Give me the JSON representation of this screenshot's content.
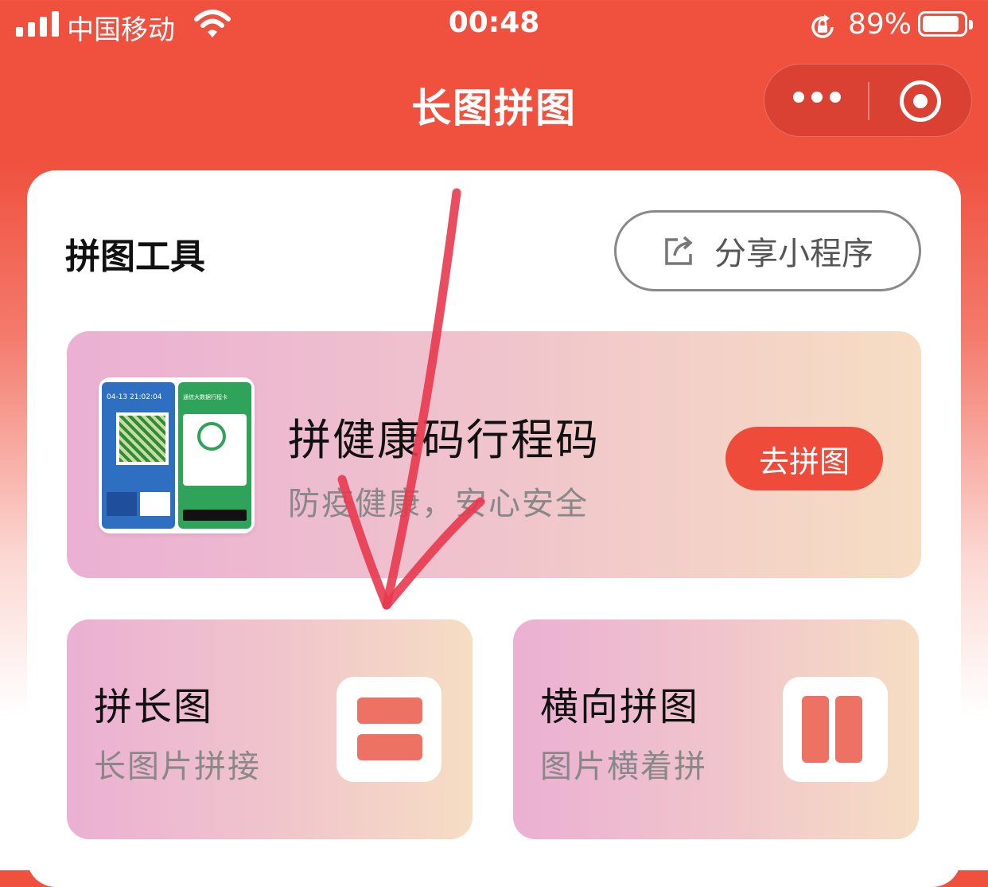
{
  "status_bar": {
    "carrier": "中国移动",
    "time": "00:48",
    "battery": "89%",
    "battery_level": 0.89
  },
  "nav": {
    "title": "长图拼图"
  },
  "main": {
    "section_title": "拼图工具",
    "share_label": "分享小程序",
    "feature": {
      "title": "拼健康码行程码",
      "subtitle": "防疫健康，安心安全",
      "button": "去拼图",
      "thumbnail": {
        "left_time": "04-13 21:02:04",
        "right_title": "通信大数据行程卡"
      }
    },
    "tools": [
      {
        "title": "拼长图",
        "subtitle": "长图片拼接",
        "icon": "stack-rows-icon"
      },
      {
        "title": "横向拼图",
        "subtitle": "图片横着拼",
        "icon": "side-columns-icon"
      }
    ]
  },
  "colors": {
    "brand": "#f0503e",
    "button": "#ee4b3a",
    "icon_fill": "#ee7264",
    "annotation": "#e8384f"
  }
}
